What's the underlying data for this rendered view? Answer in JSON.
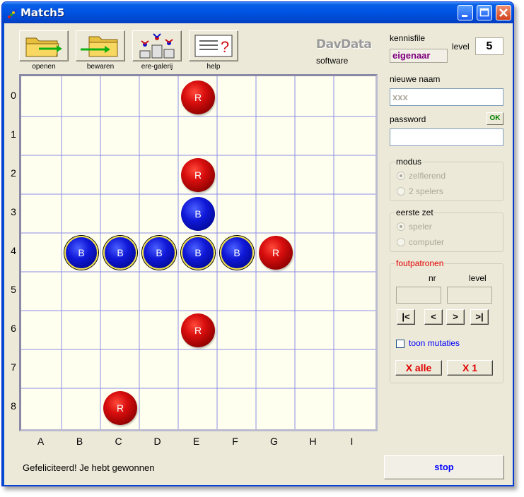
{
  "window": {
    "title": "Match5"
  },
  "toolbar": [
    {
      "label": "openen"
    },
    {
      "label": "bewaren"
    },
    {
      "label": "ere-galerij"
    },
    {
      "label": "help"
    }
  ],
  "logo": {
    "brand": "DavData",
    "sub": "software"
  },
  "board": {
    "rows": [
      "0",
      "1",
      "2",
      "3",
      "4",
      "5",
      "6",
      "7",
      "8"
    ],
    "cols": [
      "A",
      "B",
      "C",
      "D",
      "E",
      "F",
      "G",
      "H",
      "I"
    ],
    "pieces": [
      {
        "label": "R",
        "color": "red",
        "row": 0,
        "col": 4
      },
      {
        "label": "R",
        "color": "red",
        "row": 2,
        "col": 4
      },
      {
        "label": "B",
        "color": "blue",
        "row": 3,
        "col": 4
      },
      {
        "label": "B",
        "color": "blue",
        "row": 4,
        "col": 1,
        "highlight": true
      },
      {
        "label": "B",
        "color": "blue",
        "row": 4,
        "col": 2,
        "highlight": true
      },
      {
        "label": "B",
        "color": "blue",
        "row": 4,
        "col": 3,
        "highlight": true
      },
      {
        "label": "B",
        "color": "blue",
        "row": 4,
        "col": 4,
        "highlight": true
      },
      {
        "label": "B",
        "color": "blue",
        "row": 4,
        "col": 5,
        "highlight": true
      },
      {
        "label": "R",
        "color": "red",
        "row": 4,
        "col": 6
      },
      {
        "label": "R",
        "color": "red",
        "row": 6,
        "col": 4
      },
      {
        "label": "R",
        "color": "red",
        "row": 8,
        "col": 2
      }
    ]
  },
  "status": "Gefeliciteerd! Je hebt gewonnen",
  "stop_label": "stop",
  "panel": {
    "kennisfile_label": "kennisfile",
    "kennisfile_value": "eigenaar",
    "level_label": "level",
    "level_value": "5",
    "nieuwe_naam_label": "nieuwe naam",
    "nieuwe_naam_value": "xxx",
    "password_label": "password",
    "ok_label": "OK",
    "modus_title": "modus",
    "modus_options": [
      "zelflerend",
      "2 spelers"
    ],
    "modus_selected": "zelflerend",
    "eerste_zet_title": "eerste zet",
    "eerste_zet_options": [
      "speler",
      "computer"
    ],
    "eerste_zet_selected": "speler",
    "foutpatronen_title": "foutpatronen",
    "nr_label": "nr",
    "fp_level_label": "level",
    "nav": [
      "|<",
      "<",
      ">",
      ">|"
    ],
    "toon_mutaties_label": "toon mutaties",
    "toon_mutaties_checked": false,
    "x_alle_label": "X alle",
    "x1_label": "X 1"
  },
  "colors": {
    "titlebar": "#0054e3",
    "window_bg": "#ece9d8",
    "board_bg": "#fffff0",
    "grid_line": "#8c8ce6",
    "red_piece": "#d80e0e",
    "blue_piece": "#1018d8",
    "highlight_ring": "#f0e050",
    "group_title_red": "#e00000",
    "link_blue": "#0000ff"
  }
}
